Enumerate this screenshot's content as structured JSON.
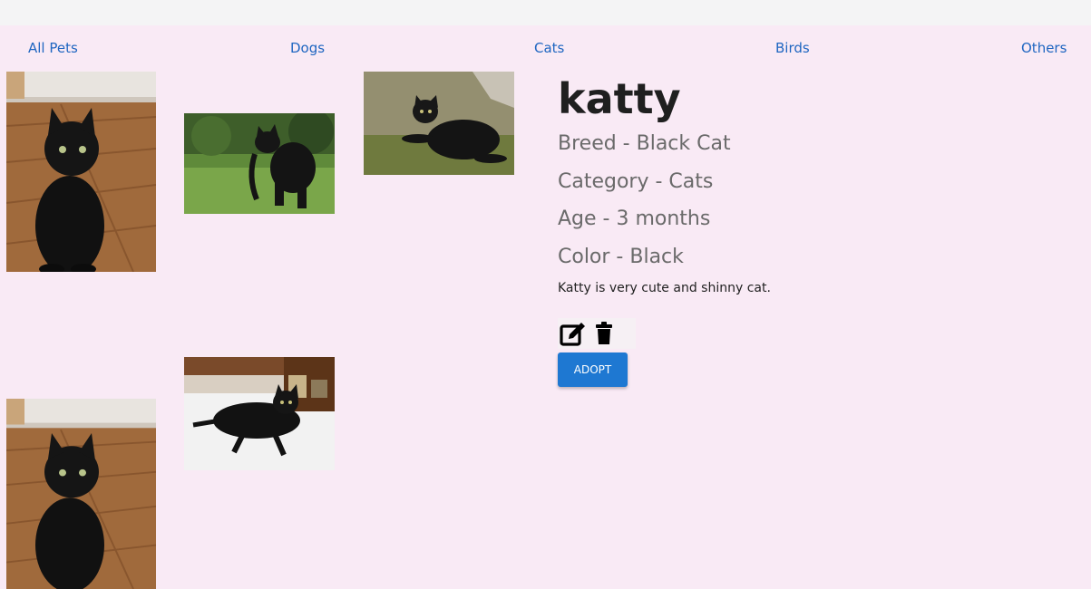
{
  "nav": {
    "items": [
      {
        "label": "All Pets"
      },
      {
        "label": "Dogs"
      },
      {
        "label": "Cats"
      },
      {
        "label": "Birds"
      },
      {
        "label": "Others"
      }
    ]
  },
  "pet": {
    "name": "katty",
    "breed": "Breed - Black Cat",
    "category": "Category - Cats",
    "age": "Age - 3 months",
    "color": "Color - Black",
    "description": "Katty is very cute and shinny cat."
  },
  "actions": {
    "edit_icon": "edit-icon",
    "delete_icon": "trash-icon",
    "adopt_label": "ADOPT"
  },
  "colors": {
    "nav_link": "#1f66c1",
    "page_background": "#f9eaf5",
    "adopt_button": "#1e78d2"
  }
}
